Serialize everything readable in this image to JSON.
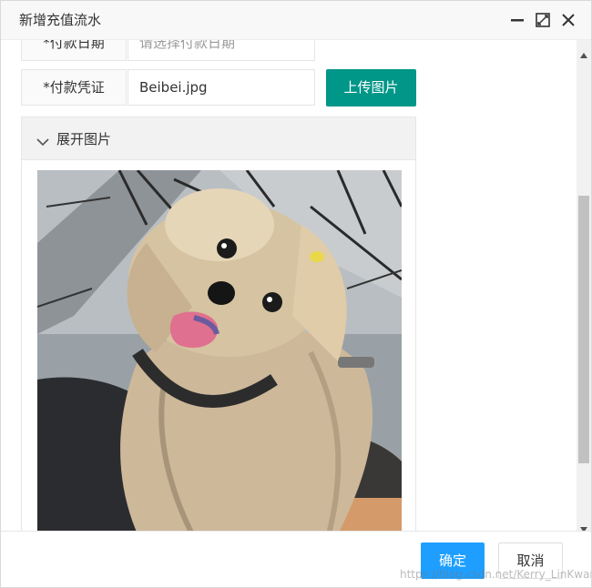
{
  "dialog": {
    "title": "新增充值流水",
    "controls": {
      "minimize_icon": "minimize-icon",
      "maximize_icon": "maximize-icon",
      "close_icon": "close-icon"
    }
  },
  "form": {
    "partial_row": {
      "label": "*付款日期",
      "placeholder": "请选择付款日期"
    },
    "voucher_row": {
      "label": "*付款凭证",
      "value": "Beibei.jpg"
    },
    "upload_button": "上传图片",
    "collapse": {
      "title": "展开图片",
      "arrow_icon": "chevron-down-icon"
    },
    "image": {
      "alt": "小狗照片"
    }
  },
  "footer": {
    "confirm": "确定",
    "cancel": "取消",
    "watermark": "https://blog.csdn.net/Kerry_LinKwan"
  },
  "colors": {
    "upload_button": "#009688",
    "confirm_button": "#1e9fff",
    "header_bg": "#f8f8f8"
  }
}
